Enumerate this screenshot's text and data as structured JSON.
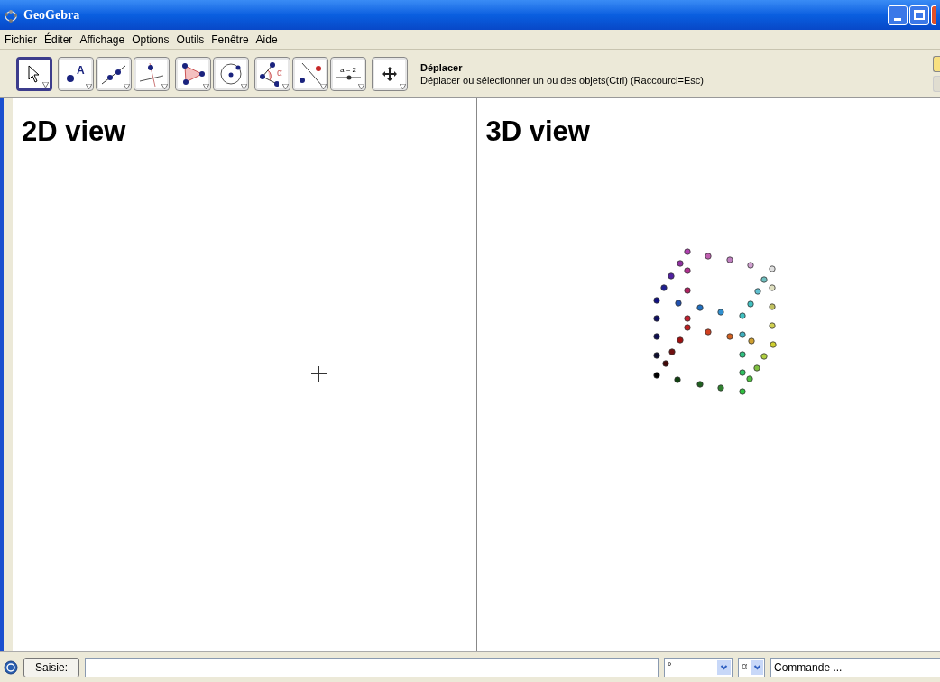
{
  "window": {
    "title": "GeoGebra"
  },
  "menu": [
    "Fichier",
    "Éditer",
    "Affichage",
    "Options",
    "Outils",
    "Fenêtre",
    "Aide"
  ],
  "tool_groups": [
    [
      {
        "kind": "move",
        "selected": true
      }
    ],
    [
      {
        "kind": "point",
        "selected": false,
        "label": "A"
      },
      {
        "kind": "line",
        "selected": false
      },
      {
        "kind": "perpendicular",
        "selected": false
      }
    ],
    [
      {
        "kind": "polygon",
        "selected": false
      },
      {
        "kind": "circle",
        "selected": false
      }
    ],
    [
      {
        "kind": "angle",
        "selected": false,
        "label": "α"
      },
      {
        "kind": "reflect",
        "selected": false
      },
      {
        "kind": "slider",
        "selected": false,
        "label": "a = 2"
      }
    ],
    [
      {
        "kind": "pan",
        "selected": false
      }
    ]
  ],
  "tool_help": {
    "name": "Déplacer",
    "description": "Déplacer ou sélectionner un ou des objets(Ctrl) (Raccourci=Esc)"
  },
  "views": [
    {
      "title": "2D view",
      "kind": "plane"
    },
    {
      "title": "3D view",
      "kind": "space"
    }
  ],
  "input_bar": {
    "button": "Saisie:",
    "symbol": "°",
    "greek": "α",
    "command": "Commande ..."
  }
}
